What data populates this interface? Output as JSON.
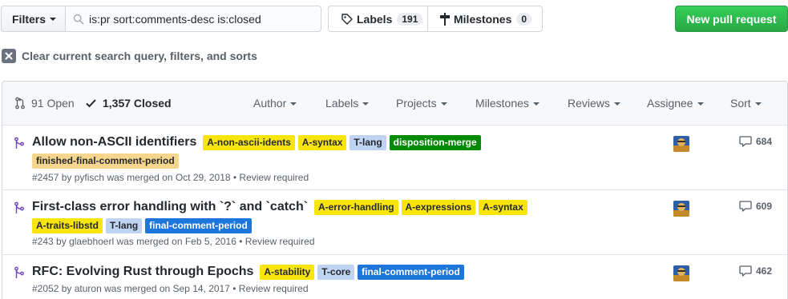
{
  "toolbar": {
    "filters_label": "Filters",
    "search_value": "is:pr sort:comments-desc is:closed",
    "labels_label": "Labels",
    "labels_count": "191",
    "milestones_label": "Milestones",
    "milestones_count": "0",
    "new_pr_label": "New pull request"
  },
  "clear_query_label": "Clear current search query, filters, and sorts",
  "header": {
    "open_label": "91 Open",
    "closed_label": "1,357 Closed",
    "menus": [
      "Author",
      "Labels",
      "Projects",
      "Milestones",
      "Reviews",
      "Assignee",
      "Sort"
    ]
  },
  "pull_requests": [
    {
      "title": "Allow non-ASCII identifiers",
      "labels": [
        {
          "text": "A-non-ascii-idents",
          "bg": "#f9e50e",
          "fg": "#24292e"
        },
        {
          "text": "A-syntax",
          "bg": "#f9e50e",
          "fg": "#24292e"
        },
        {
          "text": "T-lang",
          "bg": "#bfd4f2",
          "fg": "#24292e"
        },
        {
          "text": "disposition-merge",
          "bg": "#008a00",
          "fg": "#ffffff"
        },
        {
          "text": "finished-final-comment-period",
          "bg": "#f6d68c",
          "fg": "#24292e"
        }
      ],
      "number": "#2457",
      "by": "by",
      "author": "pyfisch",
      "merged_text": "was merged on Oct 29, 2018",
      "review": "• Review required",
      "comments": "684"
    },
    {
      "title": "First-class error handling with `?` and `catch`",
      "labels": [
        {
          "text": "A-error-handling",
          "bg": "#f9e50e",
          "fg": "#24292e"
        },
        {
          "text": "A-expressions",
          "bg": "#f9e50e",
          "fg": "#24292e"
        },
        {
          "text": "A-syntax",
          "bg": "#f9e50e",
          "fg": "#24292e"
        },
        {
          "text": "A-traits-libstd",
          "bg": "#f9e50e",
          "fg": "#24292e"
        },
        {
          "text": "T-lang",
          "bg": "#bfd4f2",
          "fg": "#24292e"
        },
        {
          "text": "final-comment-period",
          "bg": "#1d76db",
          "fg": "#ffffff"
        }
      ],
      "number": "#243",
      "by": "by",
      "author": "glaebhoerl",
      "merged_text": "was merged on Feb 5, 2016",
      "review": "• Review required",
      "comments": "609"
    },
    {
      "title": "RFC: Evolving Rust through Epochs",
      "labels": [
        {
          "text": "A-stability",
          "bg": "#f9e50e",
          "fg": "#24292e"
        },
        {
          "text": "T-core",
          "bg": "#bfd4f2",
          "fg": "#24292e"
        },
        {
          "text": "final-comment-period",
          "bg": "#1d76db",
          "fg": "#ffffff"
        }
      ],
      "number": "#2052",
      "by": "by",
      "author": "aturon",
      "merged_text": "was merged on Sep 14, 2017",
      "review": "• Review required",
      "comments": "462"
    }
  ],
  "icons": {
    "merged": "git-merge-icon",
    "comment": "comment-icon",
    "tag": "tag-icon",
    "milestone": "milestone-icon",
    "search": "search-icon",
    "pr": "pull-request-icon",
    "check": "check-icon"
  },
  "colors": {
    "merged_purple": "#6f42c1",
    "primary_green": "#28a745"
  }
}
